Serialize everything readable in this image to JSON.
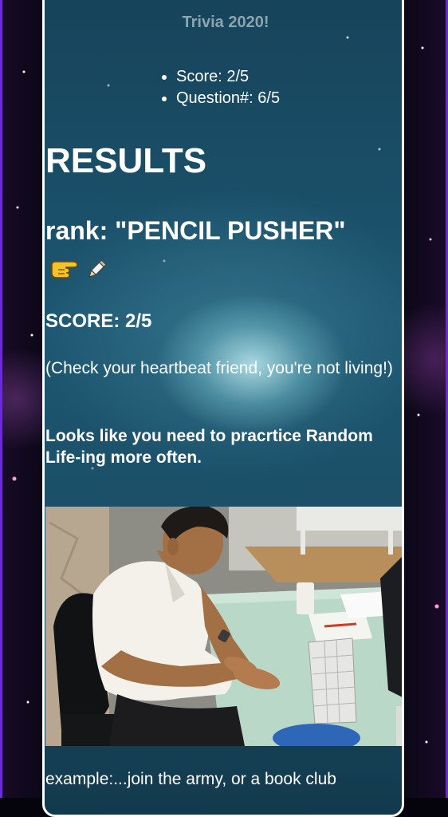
{
  "app": {
    "title": "Trivia 2020!"
  },
  "stats": {
    "score": "Score: 2/5",
    "question": "Question#: 6/5"
  },
  "results": {
    "heading": "RESULTS",
    "rank_text": "rank: \"PENCIL PUSHER\"",
    "rank_icons": [
      "pointing-hand-icon",
      "pencil-icon"
    ],
    "score": "SCORE: 2/5",
    "feedback": "(Check your heartbeat friend, you're not living!)",
    "advice": "Looks like you need to pracrtice Random Life-ing more often.",
    "image_alt": "man at desk",
    "example": "example:...join the army, or a book club"
  },
  "colors": {
    "card_border": "#ffffff",
    "title_text": "#8ea3ac",
    "body_text": "#ffffff",
    "frame_edge": "#6a2bd6"
  }
}
